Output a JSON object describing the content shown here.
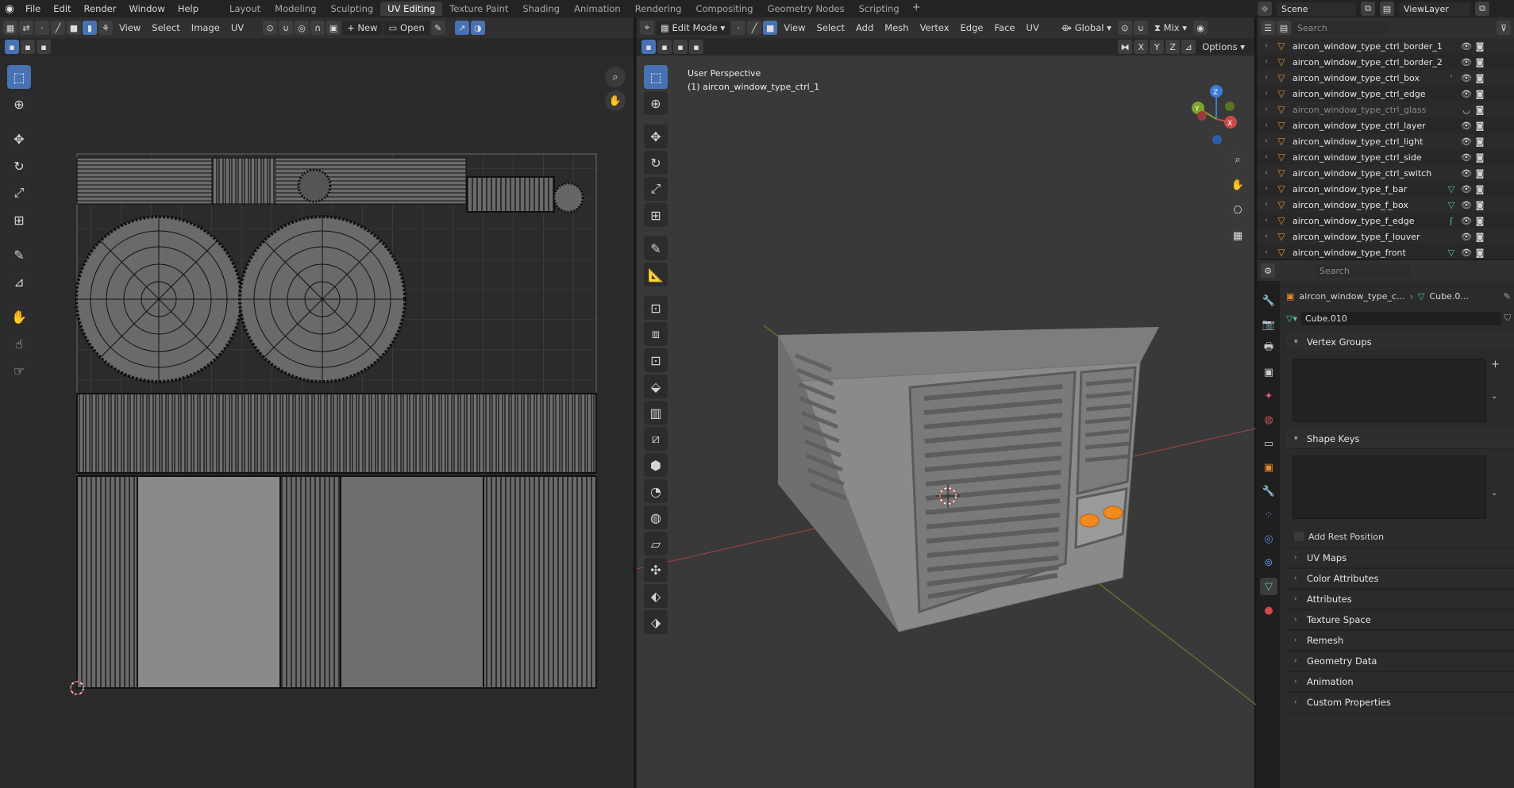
{
  "topbar": {
    "menus": [
      "File",
      "Edit",
      "Render",
      "Window",
      "Help"
    ],
    "workspaces": [
      "Layout",
      "Modeling",
      "Sculpting",
      "UV Editing",
      "Texture Paint",
      "Shading",
      "Animation",
      "Rendering",
      "Compositing",
      "Geometry Nodes",
      "Scripting"
    ],
    "active_workspace": "UV Editing",
    "add_symbol": "+",
    "scene": "Scene",
    "view_layer": "ViewLayer"
  },
  "uv_editor": {
    "header_menus": [
      "View",
      "Select",
      "Image",
      "UV"
    ],
    "new_label": "New",
    "open_label": "Open",
    "grid_color": "#606060",
    "accent": "#4772b3"
  },
  "viewport": {
    "mode": "Edit Mode",
    "header_menus": [
      "View",
      "Select",
      "Add",
      "Mesh",
      "Vertex",
      "Edge",
      "Face",
      "UV"
    ],
    "transform_orientation": "Global",
    "shading_mix": "Mix",
    "options_label": "Options",
    "axis_toggles": [
      "X",
      "Y",
      "Z"
    ],
    "overlay_line1": "User Perspective",
    "overlay_line2": "(1) aircon_window_type_ctrl_1",
    "gizmo_labels": {
      "x": "X",
      "y": "Y",
      "z": "Z"
    },
    "axis_colors": {
      "x": "#c94a4a",
      "y": "#7ea32a",
      "z": "#3a7ad8"
    }
  },
  "outliner": {
    "search_placeholder": "Search",
    "items": [
      {
        "label": "aircon_window_type_ctrl_border_1",
        "dim": false,
        "mod": ""
      },
      {
        "label": "aircon_window_type_ctrl_border_2",
        "dim": false,
        "mod": ""
      },
      {
        "label": "aircon_window_type_ctrl_box",
        "dim": false,
        "mod": "'"
      },
      {
        "label": "aircon_window_type_ctrl_edge",
        "dim": false,
        "mod": ""
      },
      {
        "label": "aircon_window_type_ctrl_glass",
        "dim": true,
        "mod": ""
      },
      {
        "label": "aircon_window_type_ctrl_layer",
        "dim": false,
        "mod": ""
      },
      {
        "label": "aircon_window_type_ctrl_light",
        "dim": false,
        "mod": ""
      },
      {
        "label": "aircon_window_type_ctrl_side",
        "dim": false,
        "mod": ""
      },
      {
        "label": "aircon_window_type_ctrl_switch",
        "dim": false,
        "mod": ""
      },
      {
        "label": "aircon_window_type_f_bar",
        "dim": false,
        "mod": "▽"
      },
      {
        "label": "aircon_window_type_f_box",
        "dim": false,
        "mod": "▽"
      },
      {
        "label": "aircon_window_type_f_edge",
        "dim": false,
        "mod": "ʃ"
      },
      {
        "label": "aircon_window_type_f_louver",
        "dim": false,
        "mod": ""
      },
      {
        "label": "aircon_window_type_front",
        "dim": false,
        "mod": "▽"
      }
    ]
  },
  "properties": {
    "search_placeholder": "Search",
    "breadcrumb_object": "aircon_window_type_c...",
    "breadcrumb_mesh": "Cube.0...",
    "mesh_name": "Cube.010",
    "panels": {
      "vertex_groups": "Vertex Groups",
      "shape_keys": "Shape Keys",
      "add_rest_position": "Add Rest Position",
      "collapsed": [
        "UV Maps",
        "Color Attributes",
        "Attributes",
        "Texture Space",
        "Remesh",
        "Geometry Data",
        "Animation",
        "Custom Properties"
      ]
    }
  }
}
